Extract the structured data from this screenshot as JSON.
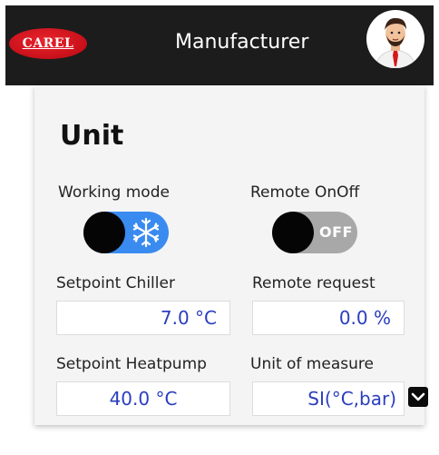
{
  "header": {
    "logo_text": "CAREL",
    "role": "Manufacturer",
    "avatar_icon": "user-avatar-icon",
    "background": "#1c1c1c",
    "brand_color": "#c8101a"
  },
  "panel": {
    "title": "Unit",
    "working_mode": {
      "label": "Working mode",
      "icon": "snowflake-icon",
      "state": "on",
      "color": "#3a8bf0"
    },
    "remote_onoff": {
      "label": "Remote OnOff",
      "state_text": "OFF",
      "color": "#a8a8a8"
    },
    "setpoint_chiller": {
      "label": "Setpoint Chiller",
      "value": "7.0 °C"
    },
    "remote_request": {
      "label": "Remote request",
      "value": "0.0 %"
    },
    "setpoint_heatpump": {
      "label": "Setpoint Heatpump",
      "value": "40.0 °C"
    },
    "unit_of_measure": {
      "label": "Unit of measure",
      "value": "SI(°C,bar)",
      "dropdown_icon": "chevron-down-icon"
    },
    "value_color": "#2a3dbf"
  }
}
